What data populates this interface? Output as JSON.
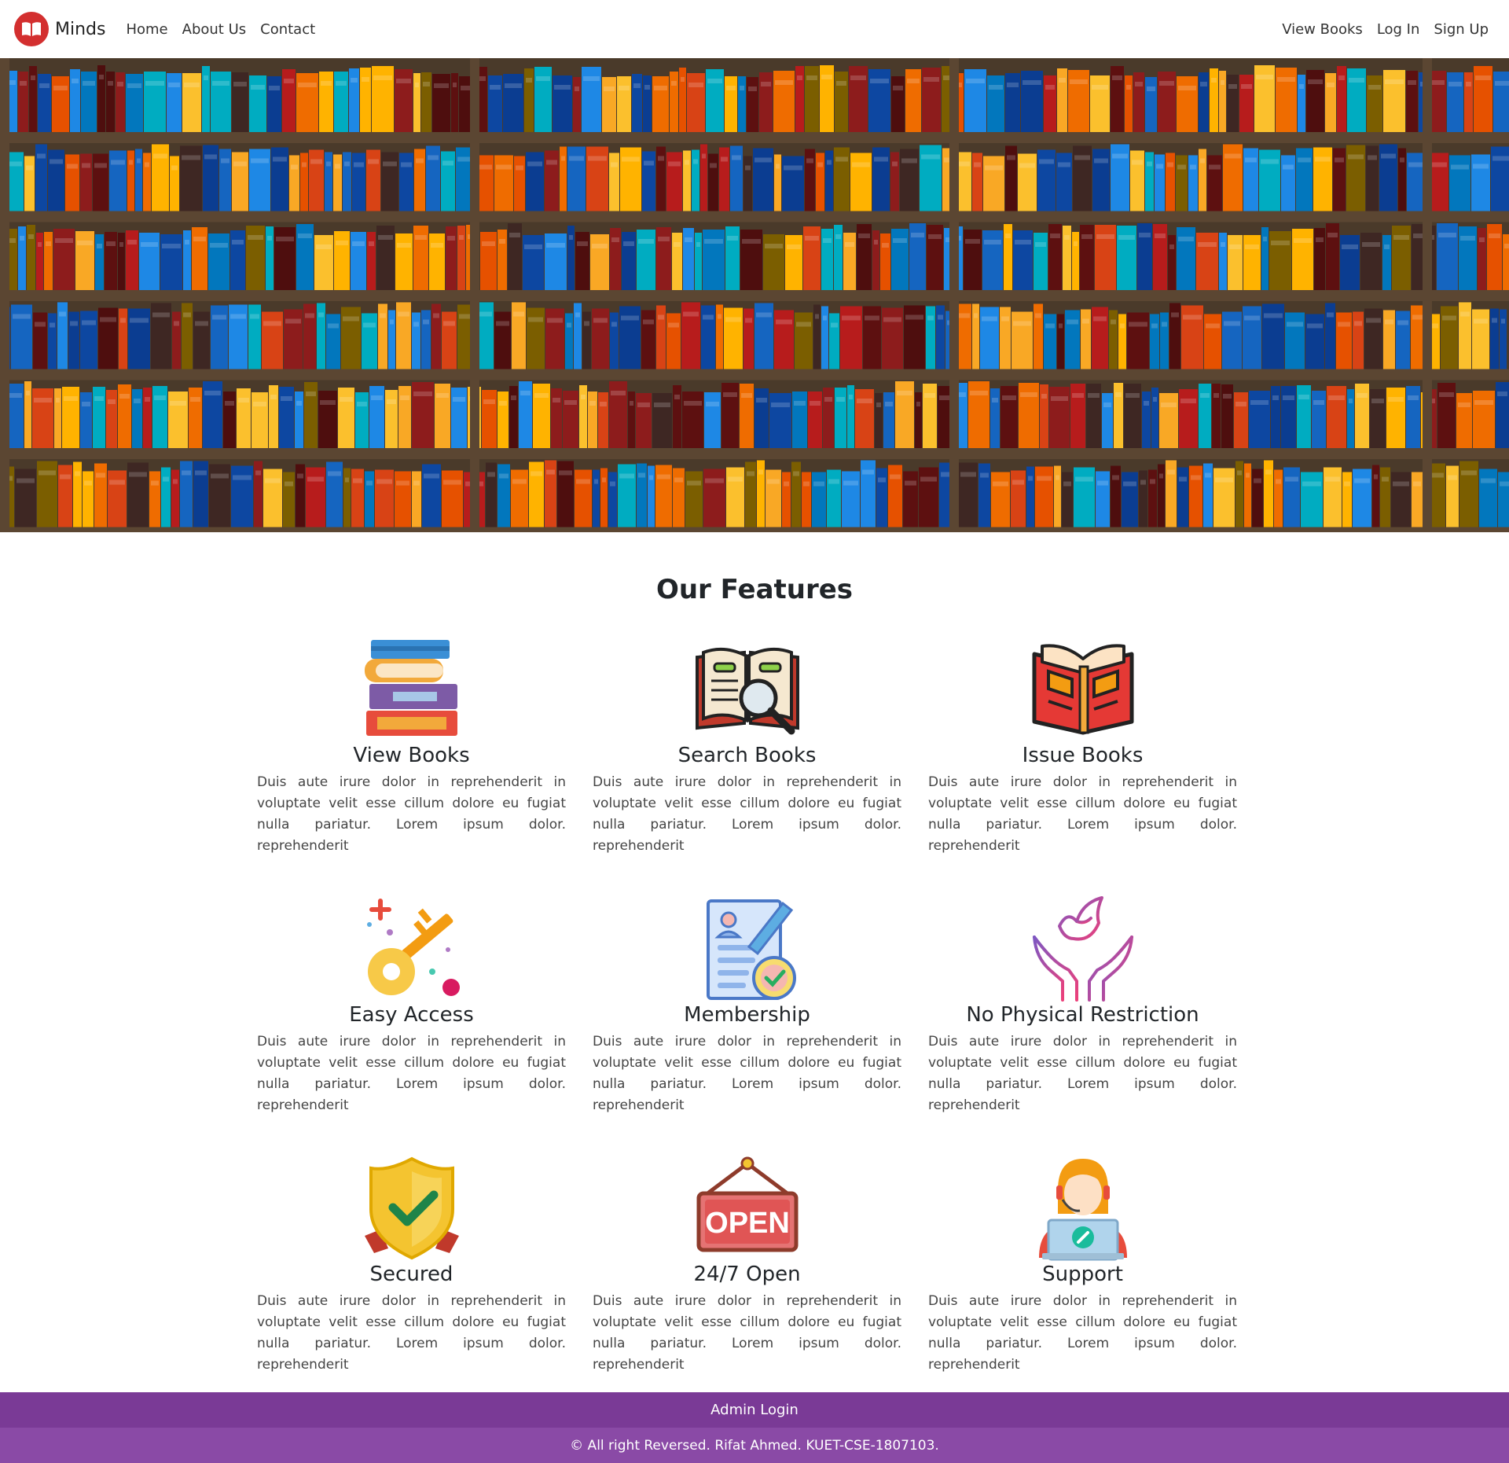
{
  "navbar": {
    "brand": "Minds",
    "left_links": [
      "Home",
      "About Us",
      "Contact"
    ],
    "right_links": [
      "View Books",
      "Log In",
      "Sign Up"
    ]
  },
  "hero": {
    "image": "bookshelf-image"
  },
  "features": {
    "title": "Our Features",
    "items": [
      {
        "icon": "books-stack-icon",
        "title": "View Books",
        "text": "Duis aute irure dolor in reprehenderit in voluptate velit esse cillum dolore eu fugiat nulla pariatur. Lorem ipsum dolor. reprehenderit"
      },
      {
        "icon": "book-magnifier-icon",
        "title": "Search Books",
        "text": "Duis aute irure dolor in reprehenderit in voluptate velit esse cillum dolore eu fugiat nulla pariatur. Lorem ipsum dolor. reprehenderit"
      },
      {
        "icon": "open-book-icon",
        "title": "Issue Books",
        "text": "Duis aute irure dolor in reprehenderit in voluptate velit esse cillum dolore eu fugiat nulla pariatur. Lorem ipsum dolor. reprehenderit"
      },
      {
        "icon": "key-icon",
        "title": "Easy Access",
        "text": "Duis aute irure dolor in reprehenderit in voluptate velit esse cillum dolore eu fugiat nulla pariatur. Lorem ipsum dolor. reprehenderit"
      },
      {
        "icon": "membership-document-icon",
        "title": "Membership",
        "text": "Duis aute irure dolor in reprehenderit in voluptate velit esse cillum dolore eu fugiat nulla pariatur. Lorem ipsum dolor. reprehenderit"
      },
      {
        "icon": "dove-hands-icon",
        "title": "No Physical Restriction",
        "text": "Duis aute irure dolor in reprehenderit in voluptate velit esse cillum dolore eu fugiat nulla pariatur. Lorem ipsum dolor. reprehenderit"
      },
      {
        "icon": "shield-check-icon",
        "title": "Secured",
        "text": "Duis aute irure dolor in reprehenderit in voluptate velit esse cillum dolore eu fugiat nulla pariatur. Lorem ipsum dolor. reprehenderit"
      },
      {
        "icon": "open-sign-icon",
        "icon_text": "OPEN",
        "title": "24/7 Open",
        "text": "Duis aute irure dolor in reprehenderit in voluptate velit esse cillum dolore eu fugiat nulla pariatur. Lorem ipsum dolor. reprehenderit"
      },
      {
        "icon": "support-agent-icon",
        "title": "Support",
        "text": "Duis aute irure dolor in reprehenderit in voluptate velit esse cillum dolore eu fugiat nulla pariatur. Lorem ipsum dolor. reprehenderit"
      }
    ]
  },
  "footer": {
    "admin_link": "Admin Login",
    "copyright": "© All right Reversed. Rifat Ahmed. KUET-CSE-1807103."
  },
  "colors": {
    "brand_red": "#d32f2f",
    "footer_purple": "#7a3a96",
    "footer_purple_light": "#8a4aa6"
  }
}
